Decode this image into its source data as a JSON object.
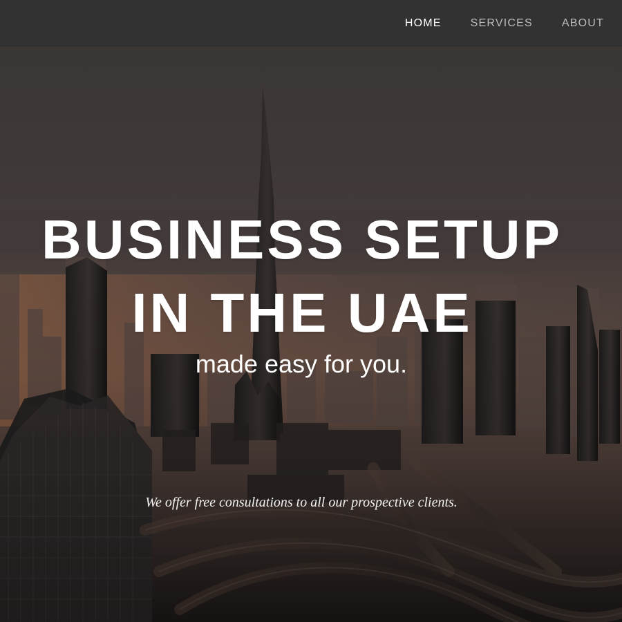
{
  "nav": {
    "items": [
      {
        "label": "HOME",
        "active": true
      },
      {
        "label": "SERVICES",
        "active": false
      },
      {
        "label": "ABOUT",
        "active": false
      }
    ]
  },
  "hero": {
    "headline_line1": "BUSINESS SETUP",
    "headline_line2": "IN THE UAE",
    "subheadline": "made easy for you.",
    "note": "We offer free consultations to all our prospective clients."
  },
  "colors": {
    "navbar_bg": "#323232",
    "nav_active": "#ffffff",
    "nav_inactive": "#bdbdbd",
    "hero_text": "#ffffff"
  },
  "icons": {
    "background": "city-skyline-icon"
  }
}
